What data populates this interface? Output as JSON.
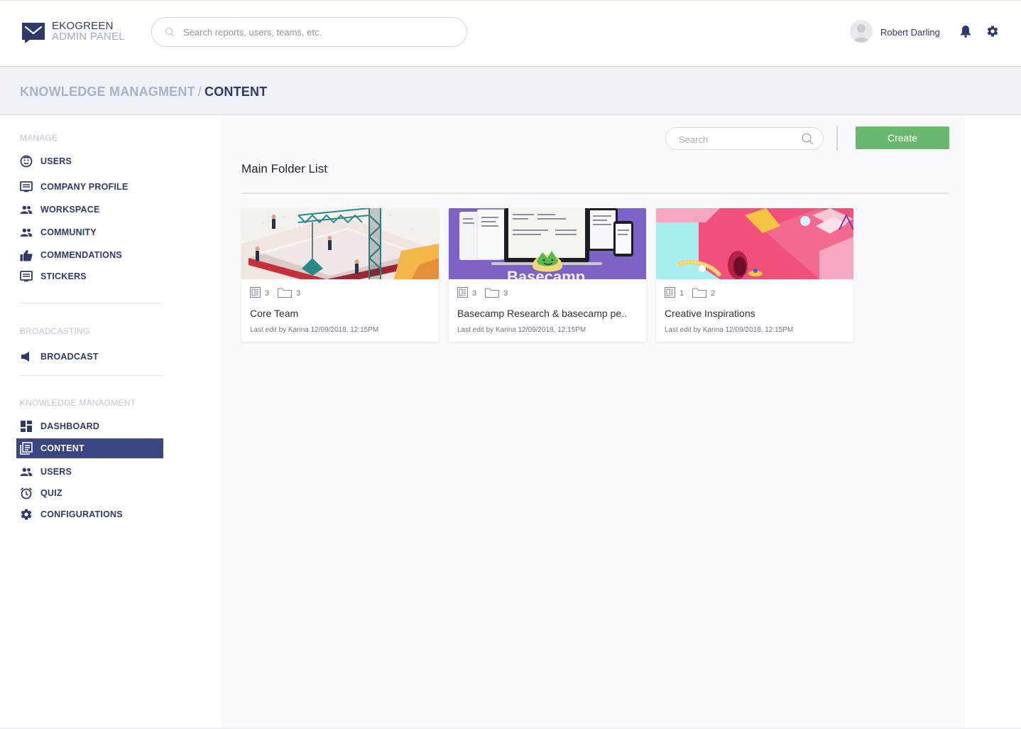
{
  "brand": {
    "line1": "EKOGREEN",
    "line2": "ADMIN PANEL"
  },
  "header": {
    "search_placeholder": "Search reports, users, teams, etc.",
    "user_name": "Robert Darling"
  },
  "breadcrumb": {
    "parent": "KNOWLEDGE MANAGMENT",
    "separator": "/",
    "current": "CONTENT"
  },
  "sidebar": {
    "sections": [
      {
        "title": "MANAGE",
        "items": [
          {
            "label": "USERS",
            "icon": "smiley-icon"
          },
          {
            "label": "COMPANY PROFILE",
            "icon": "profile-card-icon"
          },
          {
            "label": "WORKSPACE",
            "icon": "people-icon"
          },
          {
            "label": "COMMUNITY",
            "icon": "people-icon"
          },
          {
            "label": "COMMENDATIONS",
            "icon": "thumbs-up-icon"
          },
          {
            "label": "STICKERS",
            "icon": "sticker-icon"
          }
        ]
      },
      {
        "title": "BROADCASTING",
        "items": [
          {
            "label": "BROADCAST",
            "icon": "megaphone-icon"
          }
        ]
      },
      {
        "title": "KNOWLEDGE MANAGMENT",
        "items": [
          {
            "label": "DASHBOARD",
            "icon": "dashboard-icon"
          },
          {
            "label": "CONTENT",
            "icon": "content-icon",
            "active": true
          },
          {
            "label": "USERS",
            "icon": "people-icon"
          },
          {
            "label": "QUIZ",
            "icon": "alarm-clock-icon"
          },
          {
            "label": "CONFIGURATIONS",
            "icon": "gear-icon"
          }
        ]
      }
    ]
  },
  "main": {
    "search_placeholder": "Search",
    "create_label": "Create",
    "title": "Main Folder List",
    "folders": [
      {
        "title": "Core Team",
        "docs": "3",
        "folders": "3",
        "last_edit": "Last edit by Karina 12/09/2018, 12:15PM",
        "thumb": "construction-illustration"
      },
      {
        "title": "Basecamp Research & basecamp pe..",
        "docs": "3",
        "folders": "3",
        "last_edit": "Last edit by Karina 12/09/2018, 12:15PM",
        "thumb": "basecamp-devices",
        "thumb_text": "Basecamp"
      },
      {
        "title": "Creative Inspirations",
        "docs": "1",
        "folders": "2",
        "last_edit": "Last edit by Karina 12/09/2018, 12:15PM",
        "thumb": "pink-isometric-illustration"
      }
    ]
  },
  "colors": {
    "primary": "#2f3a6b",
    "active_nav": "#3b4581",
    "create_button": "#6ab86e",
    "crumb_bg": "#eef1f6"
  }
}
